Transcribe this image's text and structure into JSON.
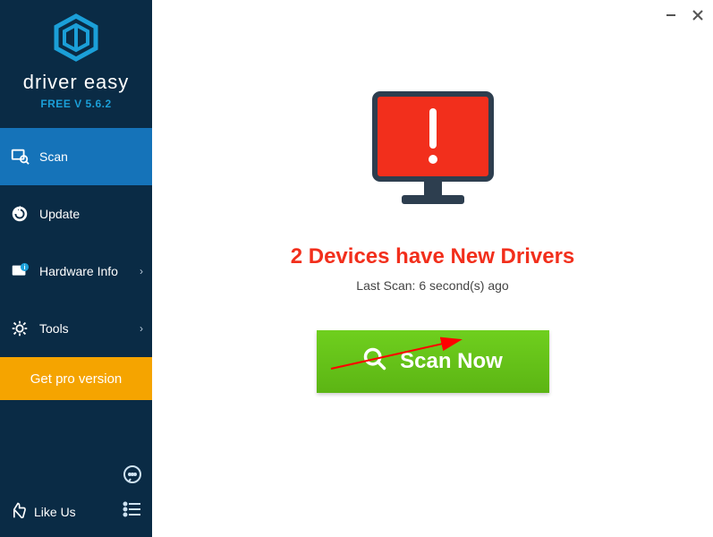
{
  "brand": {
    "name": "driver easy",
    "version": "FREE V 5.6.2"
  },
  "sidebar": {
    "items": [
      {
        "label": "Scan"
      },
      {
        "label": "Update"
      },
      {
        "label": "Hardware Info"
      },
      {
        "label": "Tools"
      }
    ],
    "pro_label": "Get pro version",
    "like_label": "Like Us"
  },
  "main": {
    "headline": "2 Devices have New Drivers",
    "subline": "Last Scan: 6 second(s) ago",
    "scan_button": "Scan Now"
  }
}
